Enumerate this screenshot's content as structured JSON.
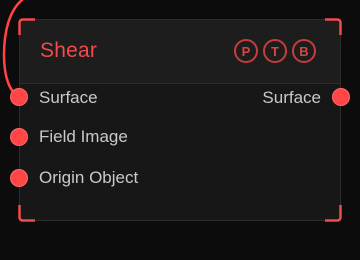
{
  "node": {
    "title": "Shear",
    "badges": [
      {
        "label": "P"
      },
      {
        "label": "T"
      },
      {
        "label": "B"
      }
    ],
    "inputs": [
      {
        "label": "Surface"
      },
      {
        "label": "Field Image"
      },
      {
        "label": "Origin Object"
      }
    ],
    "outputs": [
      {
        "label": "Surface"
      }
    ]
  },
  "colors": {
    "accent": "#f24b4b",
    "socket": "#ff4545",
    "node_bg": "#171717",
    "header_bg": "#1d1d1d",
    "canvas_bg": "#0c0c0c",
    "label_text": "#c9c9c9"
  }
}
